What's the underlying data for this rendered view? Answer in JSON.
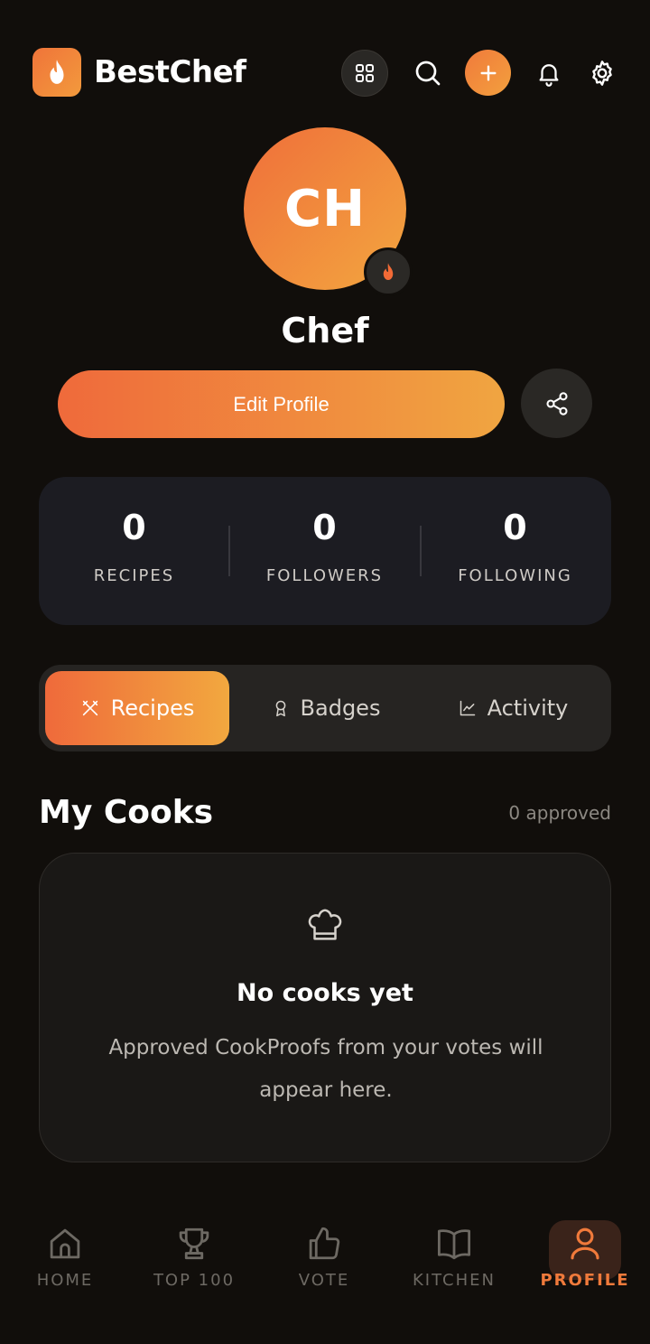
{
  "header": {
    "app_name": "BestChef",
    "icons": [
      "flame-logo-icon",
      "grid-icon",
      "search-icon",
      "plus-icon",
      "bell-icon",
      "gear-icon"
    ]
  },
  "profile": {
    "initials": "CH",
    "name": "Chef",
    "edit_label": "Edit Profile"
  },
  "stats": [
    {
      "value": "0",
      "label": "RECIPES"
    },
    {
      "value": "0",
      "label": "FOLLOWERS"
    },
    {
      "value": "0",
      "label": "FOLLOWING"
    }
  ],
  "tabs": [
    {
      "label": "Recipes",
      "icon": "utensils-icon",
      "active": true
    },
    {
      "label": "Badges",
      "icon": "award-icon",
      "active": false
    },
    {
      "label": "Activity",
      "icon": "chart-icon",
      "active": false
    }
  ],
  "section": {
    "title": "My Cooks",
    "meta": "0 approved"
  },
  "empty_state": {
    "title": "No cooks yet",
    "description": "Approved CookProofs from your votes will appear here."
  },
  "nav": [
    {
      "label": "HOME",
      "icon": "home-icon"
    },
    {
      "label": "TOP 100",
      "icon": "trophy-icon"
    },
    {
      "label": "VOTE",
      "icon": "thumbs-up-icon"
    },
    {
      "label": "KITCHEN",
      "icon": "book-icon"
    },
    {
      "label": "PROFILE",
      "icon": "user-icon",
      "active": true
    }
  ],
  "colors": {
    "background": "#110e0b",
    "accent_start": "#ef6a3b",
    "accent_end": "#f2a83f",
    "card": "#1c1c22",
    "inactive_nav": "#6d6963"
  }
}
